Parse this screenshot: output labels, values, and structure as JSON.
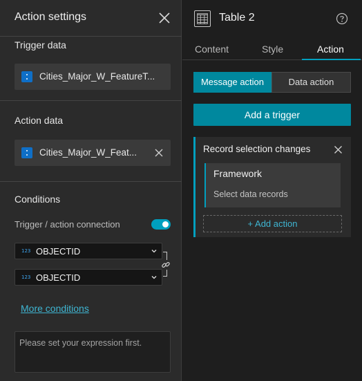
{
  "left_panel": {
    "title": "Action settings",
    "trigger_data": {
      "heading": "Trigger data",
      "source": "Cities_Major_W_FeatureT..."
    },
    "action_data": {
      "heading": "Action data",
      "source": "Cities_Major_W_Feat..."
    },
    "conditions": {
      "heading": "Conditions",
      "connection_label": "Trigger / action connection",
      "connection_enabled": true,
      "trigger_field": {
        "type_badge": "123",
        "name": "OBJECTID"
      },
      "action_field": {
        "type_badge": "123",
        "name": "OBJECTID"
      },
      "more_conditions_link": "More conditions",
      "expression_placeholder": "Please set your expression first."
    }
  },
  "right_panel": {
    "title": "Table 2",
    "tabs": [
      {
        "label": "Content",
        "active": false
      },
      {
        "label": "Style",
        "active": false
      },
      {
        "label": "Action",
        "active": true
      }
    ],
    "segments": [
      {
        "label": "Message action",
        "active": true
      },
      {
        "label": "Data action",
        "active": false
      }
    ],
    "add_trigger_label": "Add a trigger",
    "trigger_card": {
      "title": "Record selection changes",
      "framework": {
        "name": "Framework",
        "description": "Select data records"
      },
      "add_action_label": "+ Add action"
    }
  },
  "colors": {
    "accent": "#00a0bf",
    "button_teal": "#00889e",
    "link": "#3fb6d3",
    "panel_bg": "#2b2b2b",
    "page_bg": "#1e1e1e"
  },
  "icons": [
    "close-icon",
    "datasource-icon",
    "chevron-down-icon",
    "link-icon",
    "table-icon",
    "help-icon"
  ]
}
